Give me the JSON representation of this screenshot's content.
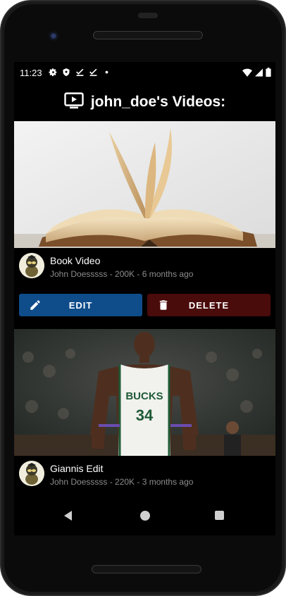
{
  "status_bar": {
    "time": "11:23",
    "left_icons": [
      "gear-icon",
      "shield-icon",
      "download-check-icon",
      "download-check-icon",
      "dot-icon"
    ],
    "right_icons": [
      "wifi-icon",
      "cell-signal-icon",
      "battery-icon"
    ]
  },
  "header": {
    "icon": "tv-play-icon",
    "title": "john_doe's Videos:"
  },
  "videos": [
    {
      "title": "Book Video",
      "subtitle": "John Doesssss - 200K - 6 months ago",
      "thumbnail": "open-book-image",
      "actions": [
        {
          "label": "EDIT",
          "icon": "pencil-icon",
          "color": "#0f4c8a"
        },
        {
          "label": "DELETE",
          "icon": "trash-icon",
          "color": "#4a0b0b"
        }
      ]
    },
    {
      "title": "Giannis Edit",
      "subtitle": "John Doesssss - 220K - 3 months ago",
      "thumbnail": "basketball-player-image"
    }
  ],
  "nav_bar": {
    "icons": [
      "back-icon",
      "home-icon",
      "recents-icon"
    ]
  },
  "colors": {
    "background": "#000000",
    "edit": "#0f4c8a",
    "delete": "#4a0b0b",
    "secondary_text": "#8c8c8c"
  }
}
